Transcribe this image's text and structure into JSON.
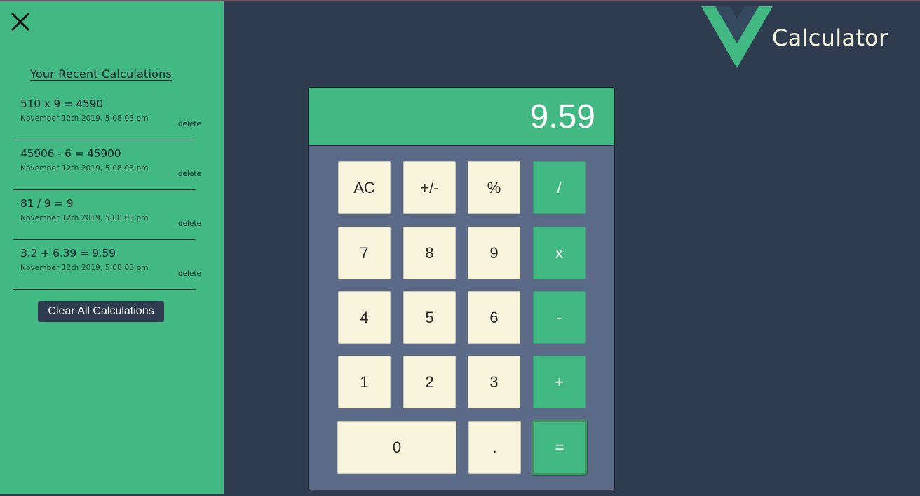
{
  "app": {
    "title": "Calculator",
    "brand_color": "#42b983",
    "bg_color": "#2f3c50"
  },
  "sidebar": {
    "close_icon": "close-icon",
    "title": "Your Recent Calculations",
    "items": [
      {
        "expression": "510 x 9 = 4590",
        "date": "November 12th 2019, 5:08:03 pm",
        "delete_label": "delete"
      },
      {
        "expression": "45906 - 6 = 45900",
        "date": "November 12th 2019, 5:08:03 pm",
        "delete_label": "delete"
      },
      {
        "expression": "81 / 9 = 9",
        "date": "November 12th 2019, 5:08:03 pm",
        "delete_label": "delete"
      },
      {
        "expression": "3.2 + 6.39 = 9.59",
        "date": "November 12th 2019, 5:08:03 pm",
        "delete_label": "delete"
      }
    ],
    "clear_label": "Clear All Calculations"
  },
  "calculator": {
    "display": "9.59",
    "keys": {
      "ac": "AC",
      "sign": "+/-",
      "percent": "%",
      "divide": "/",
      "seven": "7",
      "eight": "8",
      "nine": "9",
      "multiply": "x",
      "four": "4",
      "five": "5",
      "six": "6",
      "subtract": "-",
      "one": "1",
      "two": "2",
      "three": "3",
      "add": "+",
      "zero": "0",
      "decimal": ".",
      "equals": "="
    }
  }
}
